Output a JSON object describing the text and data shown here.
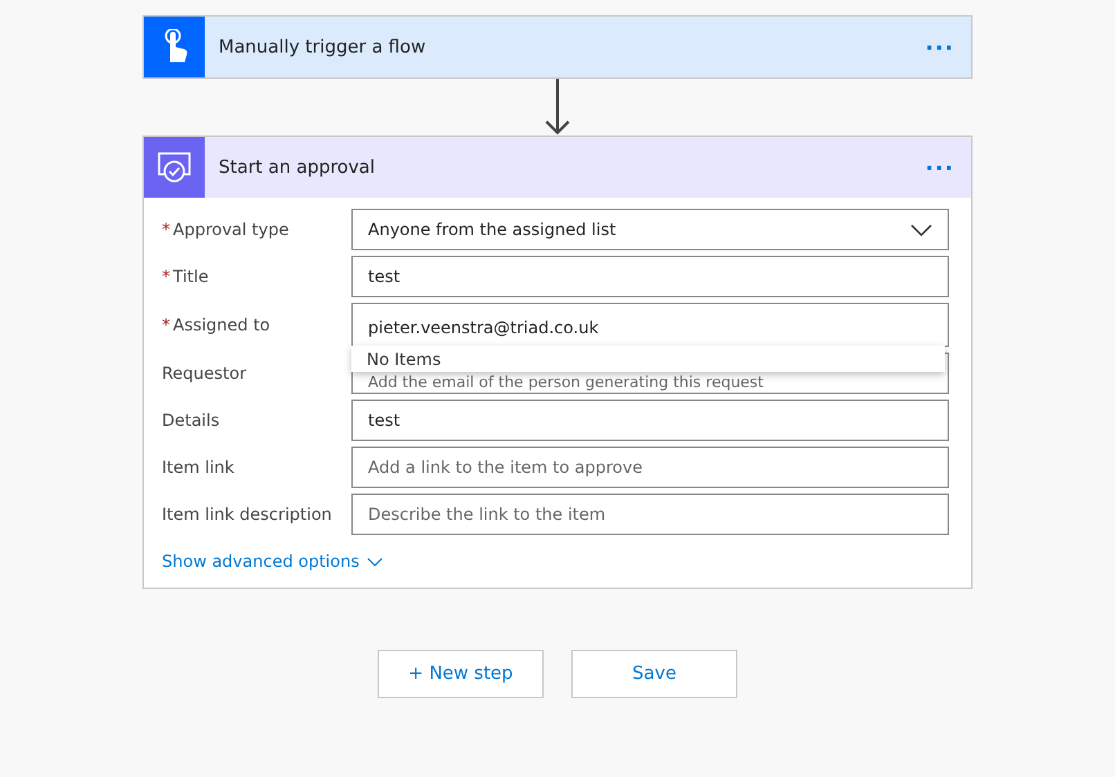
{
  "trigger": {
    "title": "Manually trigger a flow",
    "menu": "···"
  },
  "approval": {
    "title": "Start an approval",
    "menu": "···",
    "fields": [
      {
        "label": "Approval type",
        "marker": "*",
        "kind": "select",
        "value": "Anyone from the assigned list"
      },
      {
        "label": "Title",
        "marker": "*",
        "kind": "input",
        "value": "test"
      },
      {
        "label": "Assigned to",
        "marker": "*",
        "kind": "people",
        "value": "pieter.veenstra@triad.co.uk",
        "suggestions": "No Items"
      },
      {
        "label": "Requestor",
        "kind": "covered",
        "placeholder": "Add the email of the person generating this request"
      },
      {
        "label": "Details",
        "kind": "input",
        "value": "test"
      },
      {
        "label": "Item link",
        "kind": "input",
        "placeholder": "Add a link to the item to approve"
      },
      {
        "label": "Item link description",
        "kind": "input",
        "placeholder": "Describe the link to the item"
      }
    ],
    "advanced": "Show advanced options"
  },
  "buttons": [
    {
      "label": "+ New step"
    },
    {
      "label": "Save"
    }
  ]
}
